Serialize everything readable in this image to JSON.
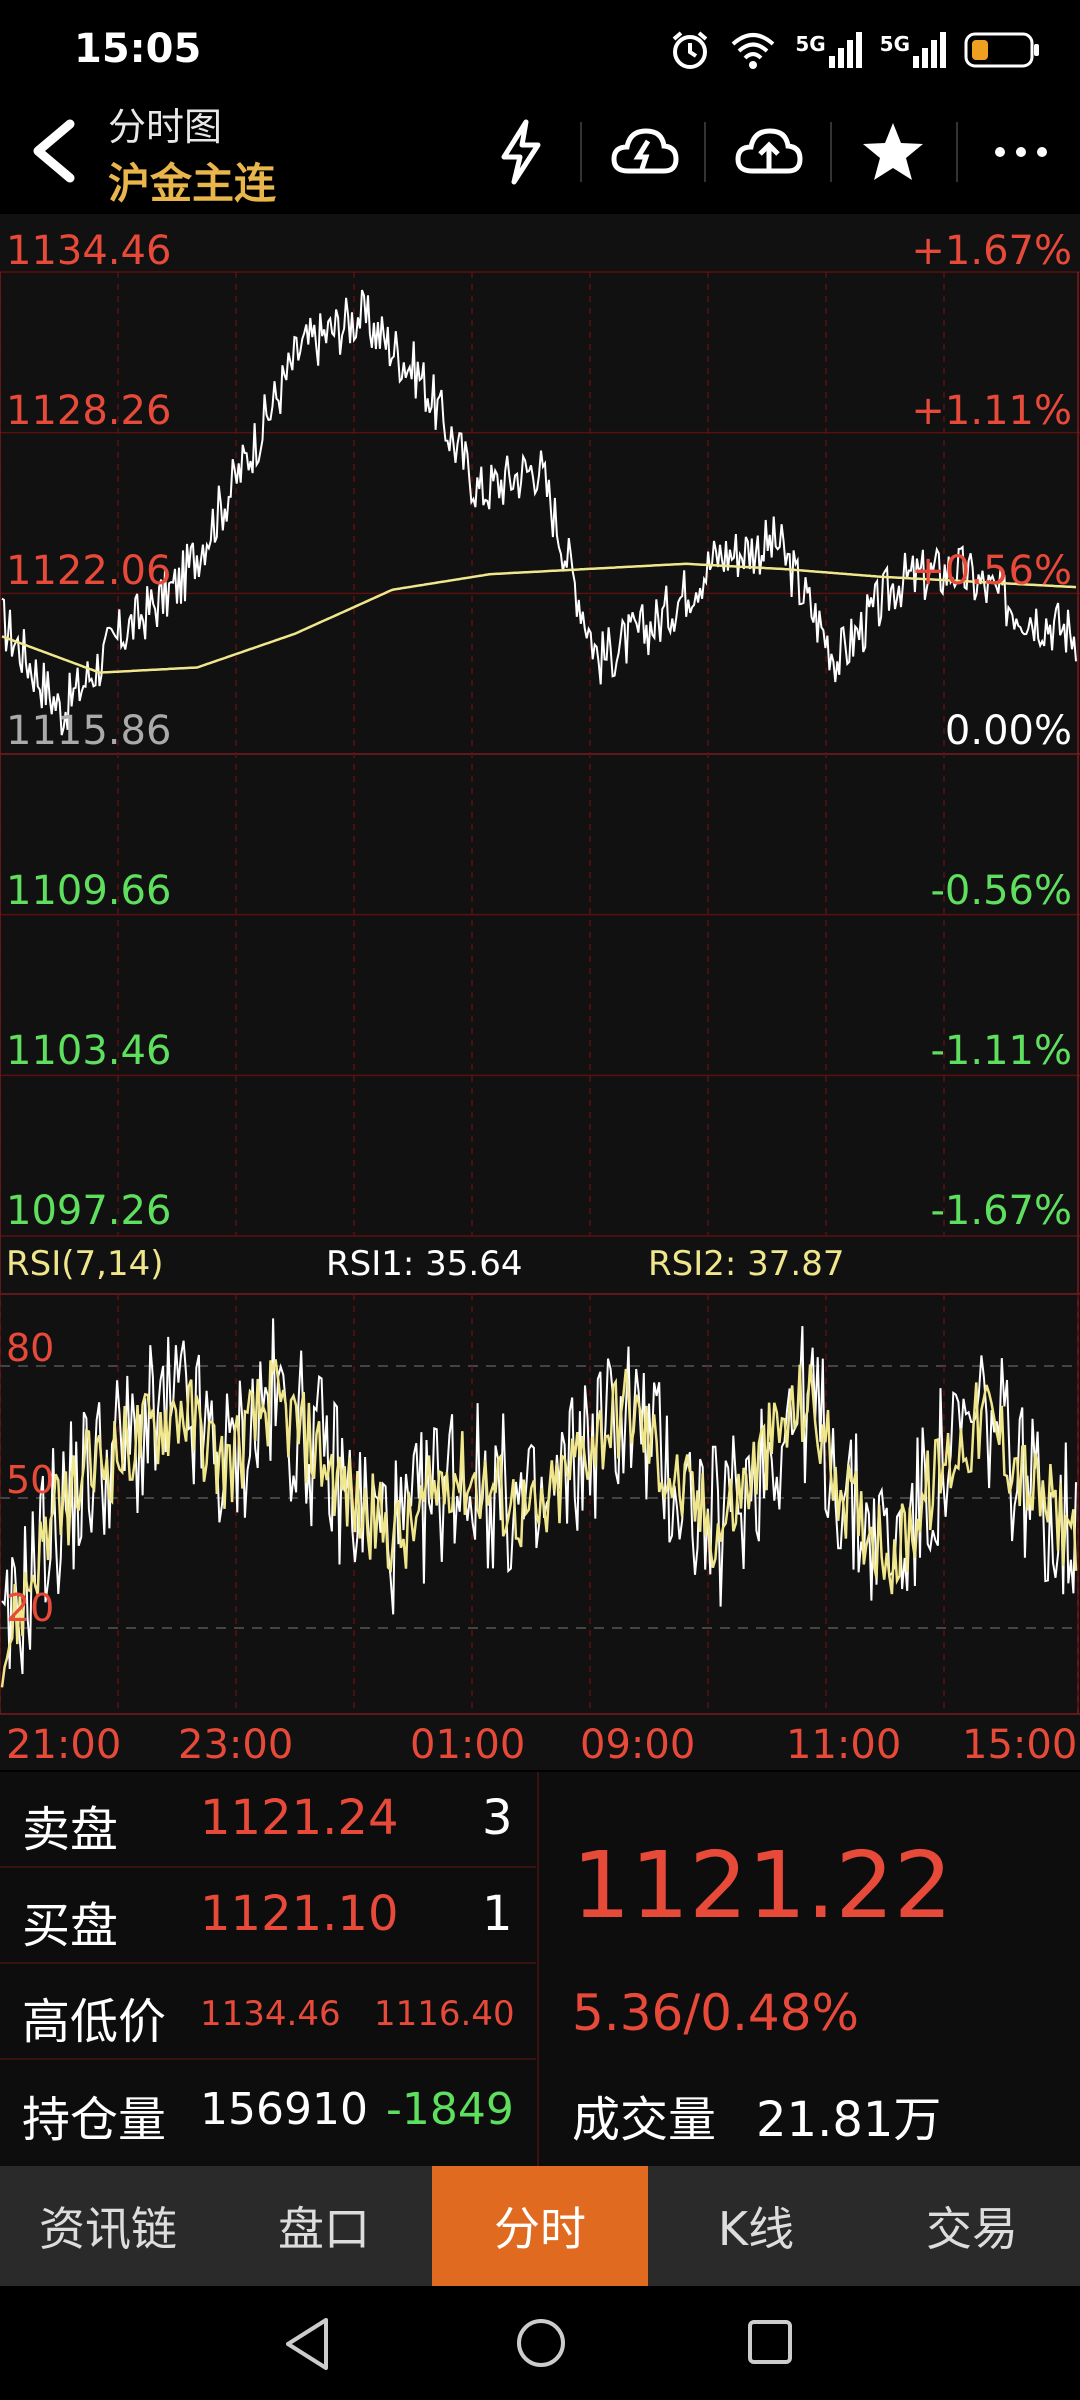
{
  "status": {
    "time": "15:05",
    "net1": "5G",
    "net2": "5G"
  },
  "header": {
    "title": "分时图",
    "subtitle": "沪金主连"
  },
  "chart": {
    "price_labels_left": [
      "1134.46",
      "1128.26",
      "1122.06",
      "1115.86",
      "1109.66",
      "1103.46",
      "1097.26"
    ],
    "pct_labels_right": [
      "+1.67%",
      "+1.11%",
      "+0.56%",
      "0.00%",
      "-0.56%",
      "-1.11%",
      "-1.67%"
    ],
    "rsi_title": "RSI(7,14)",
    "rsi1": "RSI1: 35.64",
    "rsi2": "RSI2: 37.87",
    "rsi_levels": [
      "80",
      "50",
      "20"
    ],
    "time_labels": [
      "21:00",
      "23:00",
      "01:00",
      "09:00",
      "11:00",
      "15:00"
    ],
    "colors": {
      "up": "#e84a3a",
      "down": "#5ee05e",
      "flat": "#ffffff",
      "avg": "#f0e68c",
      "grid": "#5a1010"
    }
  },
  "chart_data": {
    "type": "line",
    "title": "",
    "xlabel": "",
    "ylabel": "",
    "ylim": [
      1097.26,
      1134.46
    ],
    "x": [
      "21:00",
      "23:00",
      "01:00",
      "09:00",
      "11:00",
      "15:00"
    ],
    "series": [
      {
        "values": [
          1119.5,
          1120.8,
          1124.5,
          1132.5,
          1124.5,
          1123.0,
          1120.5
        ]
      },
      {
        "values": [
          1119.0,
          1118.8,
          1121.0,
          1123.0,
          1123.3,
          1122.5,
          1122.3
        ]
      }
    ]
  },
  "info": {
    "sell_label": "卖盘",
    "sell_price": "1121.24",
    "sell_qty": "3",
    "buy_label": "买盘",
    "buy_price": "1121.10",
    "buy_qty": "1",
    "hl_label": "高低价",
    "high": "1134.46",
    "low": "1116.40",
    "oi_label": "持仓量",
    "oi": "156910",
    "oi_change": "-1849",
    "last_price": "1121.22",
    "change": "5.36/0.48%",
    "vol_label": "成交量",
    "volume": "21.81万"
  },
  "tabs": [
    "资讯链",
    "盘口",
    "分时",
    "K线",
    "交易"
  ],
  "active_tab_index": 2
}
